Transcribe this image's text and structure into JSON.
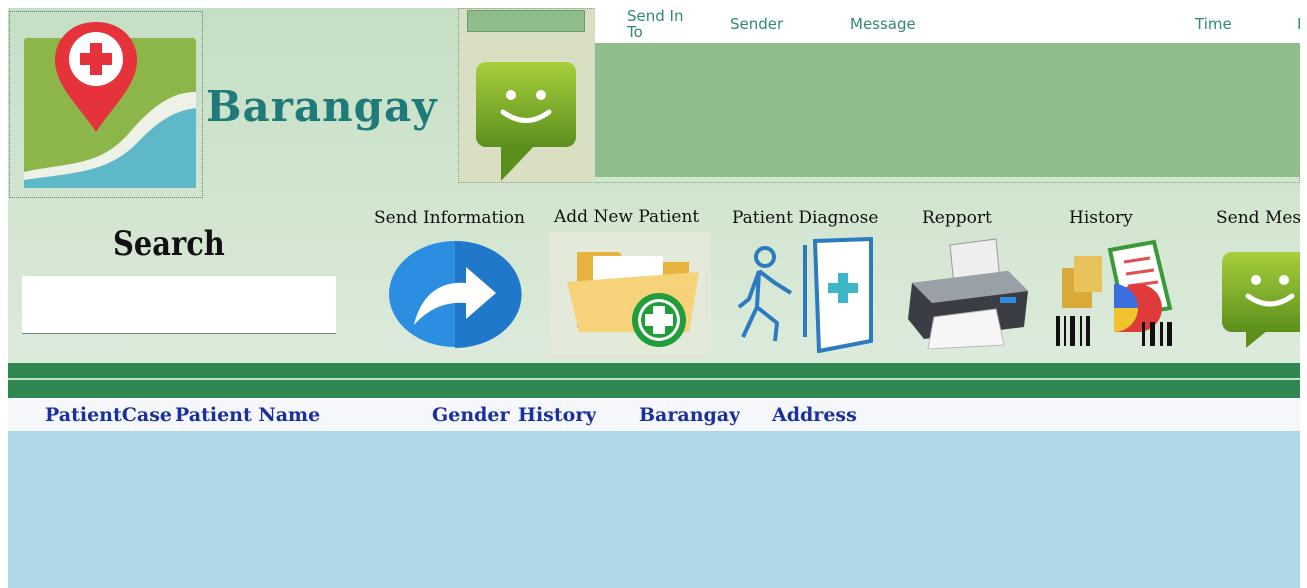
{
  "brand": {
    "name": "Barangay"
  },
  "messages": {
    "columns": [
      "Send In\nTo",
      "Sender",
      "Message",
      "Time",
      "I"
    ]
  },
  "search": {
    "title": "Search",
    "value": ""
  },
  "toolbar": {
    "items": [
      {
        "label": "Send Information",
        "icon": "share-arrow-icon"
      },
      {
        "label": "Add New Patient",
        "icon": "add-folder-icon"
      },
      {
        "label": "Patient Diagnose",
        "icon": "patient-door-icon"
      },
      {
        "label": "Repport",
        "icon": "printer-icon"
      },
      {
        "label": "History",
        "icon": "history-report-icon"
      },
      {
        "label": "Send Mes",
        "icon": "message-icon"
      }
    ]
  },
  "grid": {
    "columns": [
      "PatientCase",
      "Patient Name",
      "Gender",
      "History",
      "Barangay",
      "Address"
    ]
  },
  "colors": {
    "header_band": "#2f8751",
    "grid_body": "#add8e6",
    "grid_header_text": "#1a2fa0",
    "message_panel": "#8fbd8b",
    "brand_text": "#1f7a7a"
  }
}
